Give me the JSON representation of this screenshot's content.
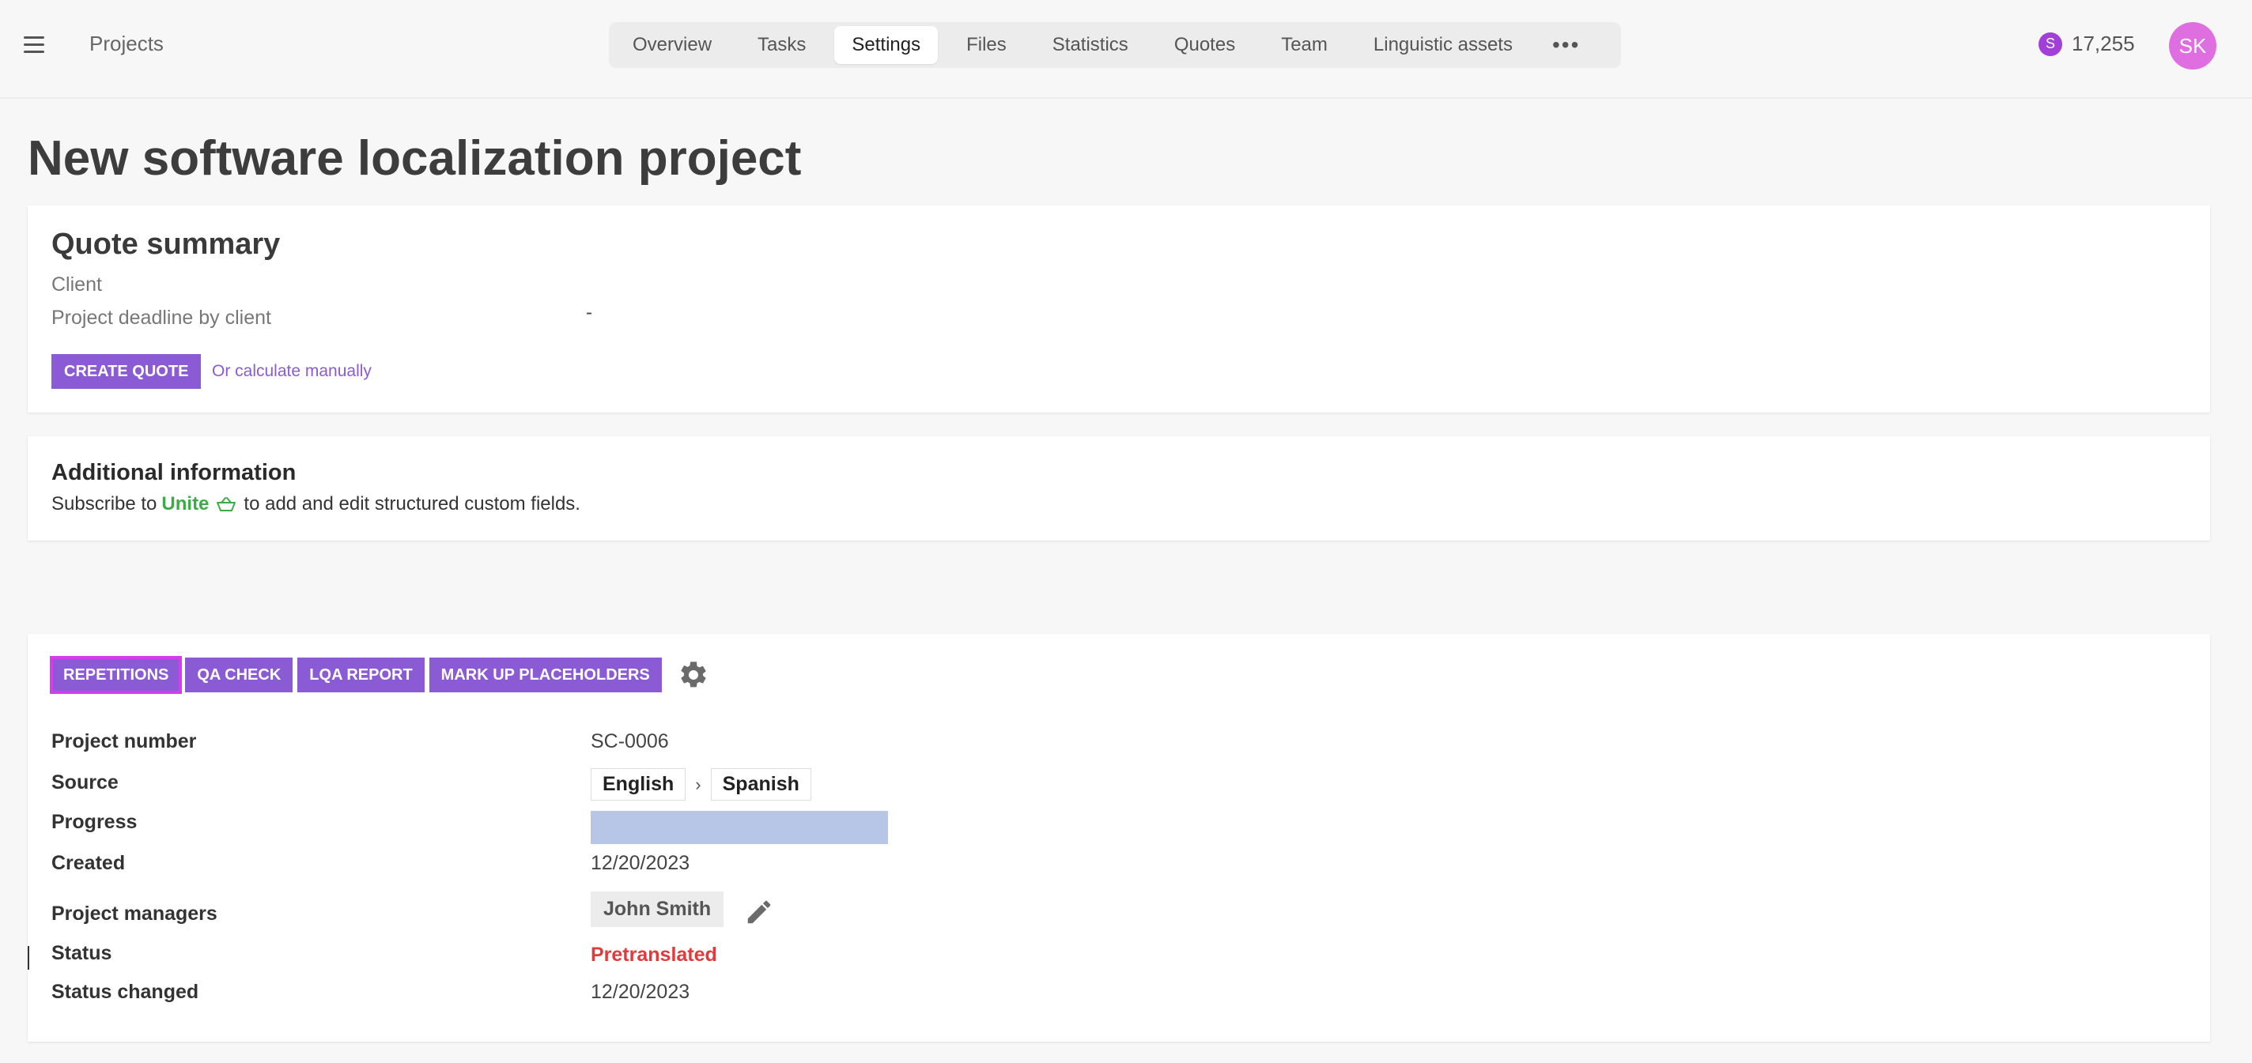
{
  "header": {
    "title": "Projects",
    "tabs": [
      {
        "label": "Overview"
      },
      {
        "label": "Tasks"
      },
      {
        "label": "Settings"
      },
      {
        "label": "Files"
      },
      {
        "label": "Statistics"
      },
      {
        "label": "Quotes"
      },
      {
        "label": "Team"
      },
      {
        "label": "Linguistic assets"
      }
    ],
    "active_tab": "Settings",
    "coin_symbol": "S",
    "balance": "17,255",
    "avatar_initials": "SK",
    "avatar_color": "#df6ee0",
    "coin_color": "#a23fd8"
  },
  "page": {
    "title": "New software localization project"
  },
  "quote_summary": {
    "title": "Quote summary",
    "client_label": "Client",
    "deadline_label": "Project deadline by client",
    "deadline_value": "-",
    "create_quote_label": "CREATE QUOTE",
    "calculate_manually_label": "Or calculate manually"
  },
  "additional_info": {
    "title": "Additional information",
    "text_before": "Subscribe to",
    "unite_label": "Unite",
    "text_after": "to add and edit structured custom fields."
  },
  "toolbar": {
    "repetitions_label": "REPETITIONS",
    "qa_check_label": "QA CHECK",
    "lqa_report_label": "LQA REPORT",
    "mark_up_placeholders_label": "MARK UP PLACEHOLDERS"
  },
  "details": {
    "project_number_label": "Project number",
    "project_number": "SC-0006",
    "source_label": "Source",
    "source_lang": "English",
    "target_lang": "Spanish",
    "progress_label": "Progress",
    "progress_percent": 100,
    "created_label": "Created",
    "created": "12/20/2023",
    "project_managers_label": "Project managers",
    "project_manager": "John Smith",
    "status_label": "Status",
    "status": "Pretranslated",
    "status_changed_label": "Status changed",
    "status_changed": "12/20/2023"
  },
  "colors": {
    "accent": "#8b5bd6",
    "status_red": "#e23a3a",
    "unite_green": "#3cab47",
    "progress_fill": "#b7c6e7"
  }
}
